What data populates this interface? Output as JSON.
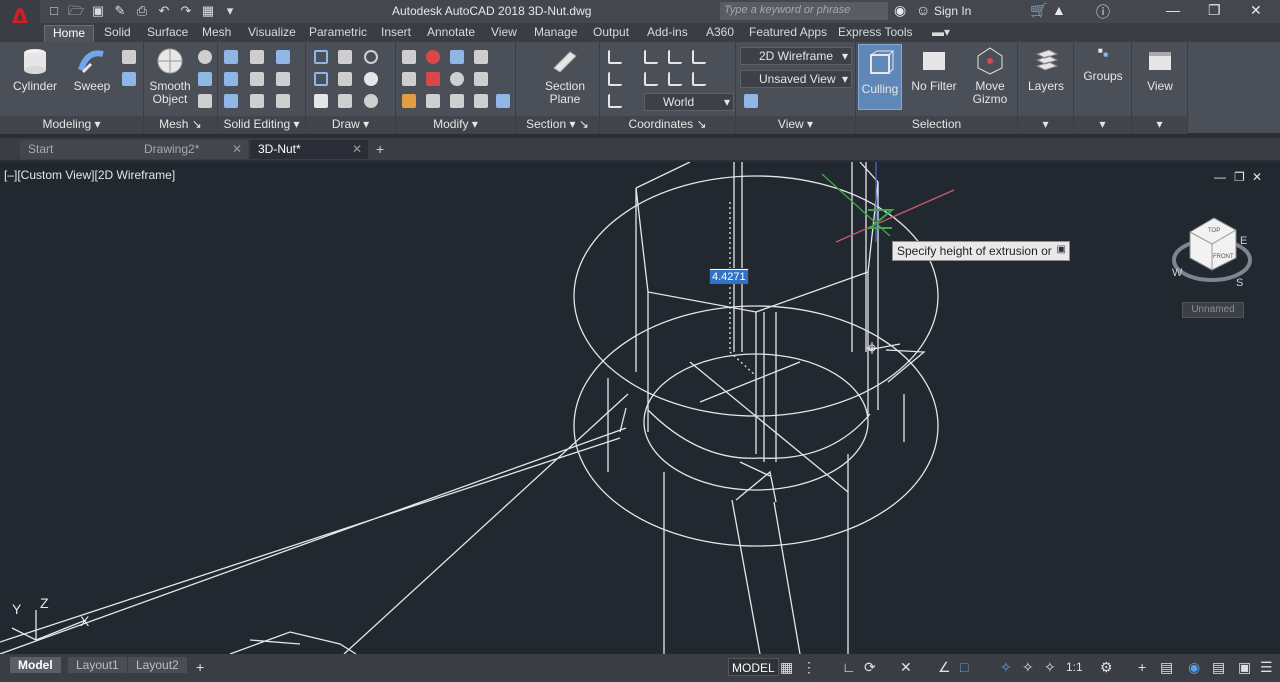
{
  "title": "Autodesk AutoCAD 2018   3D-Nut.dwg",
  "search_placeholder": "Type a keyword or phrase",
  "sign_in": "Sign In",
  "ribbon_tabs": [
    "Home",
    "Solid",
    "Surface",
    "Mesh",
    "Visualize",
    "Parametric",
    "Insert",
    "Annotate",
    "View",
    "Manage",
    "Output",
    "Add-ins",
    "A360",
    "Featured Apps",
    "Express Tools"
  ],
  "panels": {
    "modeling": {
      "title": "Modeling",
      "cylinder": "Cylinder",
      "sweep": "Sweep"
    },
    "mesh": {
      "title": "Mesh",
      "smooth_object_1": "Smooth",
      "smooth_object_2": "Object"
    },
    "solid_editing": {
      "title": "Solid Editing"
    },
    "draw": {
      "title": "Draw"
    },
    "modify": {
      "title": "Modify"
    },
    "section": {
      "title": "Section",
      "section_plane_1": "Section",
      "section_plane_2": "Plane"
    },
    "coordinates": {
      "title": "Coordinates",
      "world": "World"
    },
    "view": {
      "title": "View",
      "visual_style": "2D Wireframe",
      "named_view": "Unsaved View"
    },
    "selection": {
      "title": "Selection",
      "culling": "Culling",
      "no_filter": "No Filter",
      "move_gizmo_1": "Move",
      "move_gizmo_2": "Gizmo"
    },
    "layers": {
      "label": "Layers"
    },
    "groups": {
      "label": "Groups"
    },
    "view_panel": {
      "label": "View"
    }
  },
  "file_tabs": [
    {
      "label": "Start"
    },
    {
      "label": "Drawing2*"
    },
    {
      "label": "3D-Nut*"
    }
  ],
  "viewport": {
    "label": "[–][Custom View][2D Wireframe]",
    "tooltip": "Specify height of extrusion or",
    "dynamic_input": "4.4271",
    "view_name": "Unnamed"
  },
  "layout_tabs": [
    "Model",
    "Layout1",
    "Layout2"
  ],
  "status": {
    "model": "MODEL",
    "scale": "1:1"
  },
  "colors": {
    "viewport_bg": "#212830",
    "ribbon_bg": "#4b4f57",
    "accent_red": "#d11f26",
    "highlight_blue": "#3072c8"
  }
}
